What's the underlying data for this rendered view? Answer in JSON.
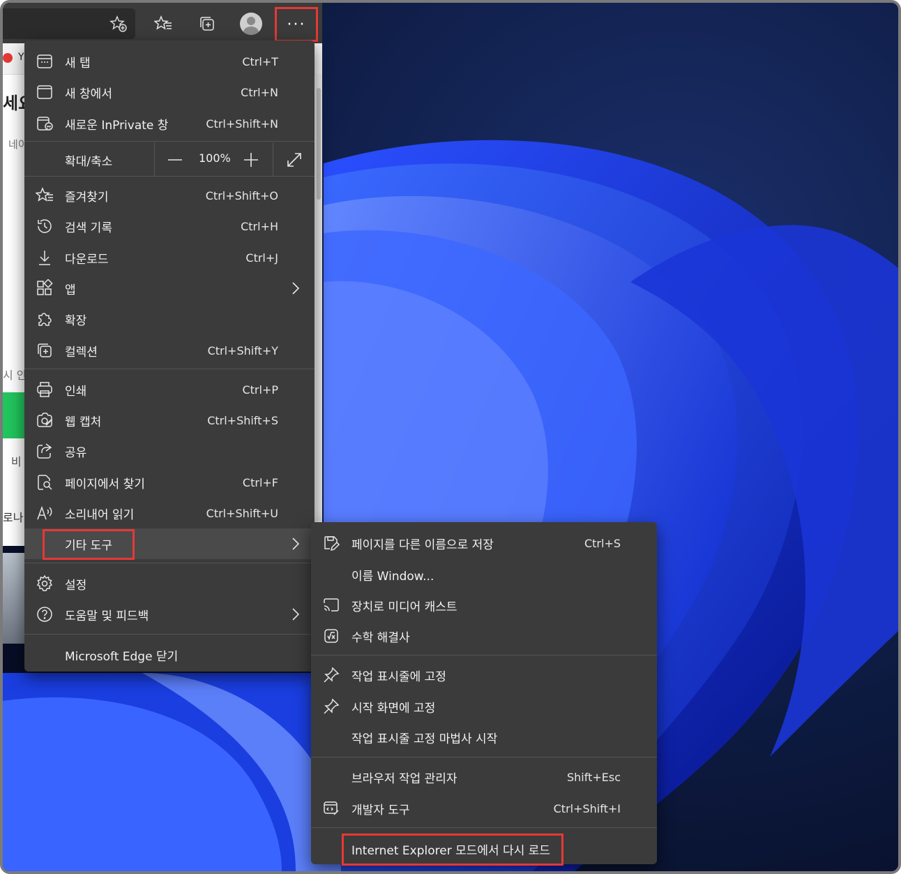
{
  "toolbar": {
    "add_favorite_icon": "star-plus-icon",
    "favorites_icon": "star-list-icon",
    "collections_icon": "collections-icon",
    "profile_icon": "avatar",
    "more_label": "···"
  },
  "background_page": {
    "tab_letter": "Y",
    "heading_fragment": "세요",
    "text_1": "네이",
    "text_2": "시 안",
    "text_3": "비",
    "text_4": "로나"
  },
  "menu": {
    "items": [
      {
        "label": "새 탭",
        "shortcut": "Ctrl+T",
        "icon": "new-tab-icon"
      },
      {
        "label": "새 창에서",
        "shortcut": "Ctrl+N",
        "icon": "new-window-icon"
      },
      {
        "label": "새로운 InPrivate 창",
        "shortcut": "Ctrl+Shift+N",
        "icon": "inprivate-icon"
      }
    ],
    "zoom": {
      "label": "확대/축소",
      "value": "100%"
    },
    "items2": [
      {
        "label": "즐겨찾기",
        "shortcut": "Ctrl+Shift+O",
        "icon": "favorites-icon"
      },
      {
        "label": "검색 기록",
        "shortcut": "Ctrl+H",
        "icon": "history-icon"
      },
      {
        "label": "다운로드",
        "shortcut": "Ctrl+J",
        "icon": "download-icon"
      },
      {
        "label": "앱",
        "shortcut": "",
        "icon": "apps-icon"
      },
      {
        "label": "확장",
        "shortcut": "",
        "icon": "extensions-icon"
      },
      {
        "label": "컬렉션",
        "shortcut": "Ctrl+Shift+Y",
        "icon": "collections-icon"
      }
    ],
    "items3": [
      {
        "label": "인쇄",
        "shortcut": "Ctrl+P",
        "icon": "print-icon"
      },
      {
        "label": "웹 캡처",
        "shortcut": "Ctrl+Shift+S",
        "icon": "web-capture-icon"
      },
      {
        "label": "공유",
        "shortcut": "",
        "icon": "share-icon"
      },
      {
        "label": "페이지에서 찾기",
        "shortcut": "Ctrl+F",
        "icon": "find-icon"
      },
      {
        "label": "소리내어 읽기",
        "shortcut": "Ctrl+Shift+U",
        "icon": "read-aloud-icon"
      },
      {
        "label": "기타 도구",
        "shortcut": "",
        "icon": ""
      }
    ],
    "items4": [
      {
        "label": "설정",
        "icon": "settings-icon"
      },
      {
        "label": "도움말 및 피드백",
        "icon": "help-icon"
      }
    ],
    "close_label": "Microsoft Edge 닫기"
  },
  "submenu": {
    "items": [
      {
        "label": "페이지를 다른 이름으로 저장",
        "shortcut": "Ctrl+S",
        "icon": "save-as-icon"
      },
      {
        "label": "이름 Window...",
        "shortcut": "",
        "icon": ""
      },
      {
        "label": "장치로 미디어 캐스트",
        "shortcut": "",
        "icon": "cast-icon"
      },
      {
        "label": "수학 해결사",
        "shortcut": "",
        "icon": "math-solver-icon"
      },
      {
        "label": "작업 표시줄에 고정",
        "shortcut": "",
        "icon": "pin-icon"
      },
      {
        "label": "시작 화면에 고정",
        "shortcut": "",
        "icon": "pin-icon"
      },
      {
        "label": "작업 표시줄 고정 마법사 시작",
        "shortcut": "",
        "icon": ""
      },
      {
        "label": "브라우저 작업 관리자",
        "shortcut": "Shift+Esc",
        "icon": ""
      },
      {
        "label": "개발자 도구",
        "shortcut": "Ctrl+Shift+I",
        "icon": "devtools-icon"
      },
      {
        "label": "Internet Explorer 모드에서 다시 로드",
        "shortcut": "",
        "icon": ""
      }
    ]
  },
  "colors": {
    "highlight_box": "#e53935",
    "menu_bg": "#3b3b3b",
    "wallpaper_blue": "#1f44ff"
  }
}
